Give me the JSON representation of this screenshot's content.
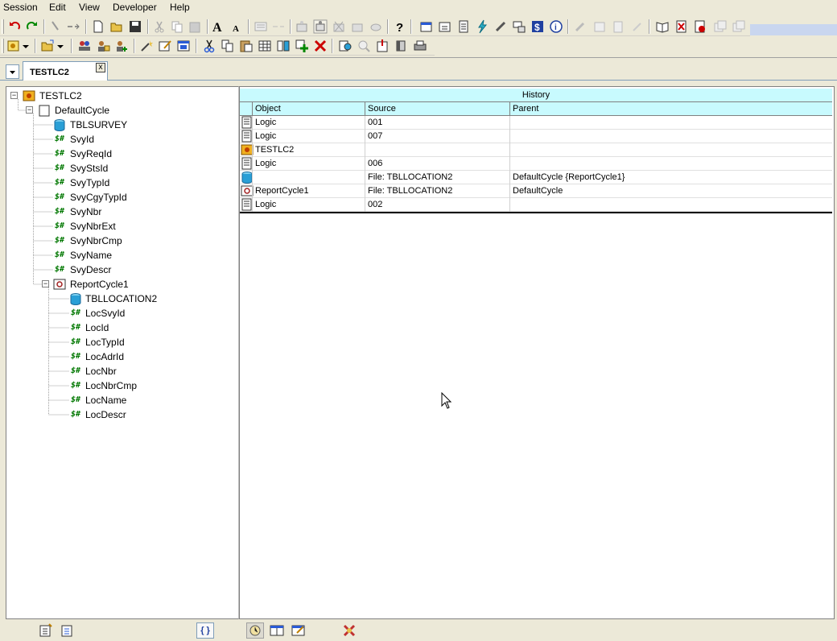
{
  "menu": {
    "items": [
      "Session",
      "Edit",
      "View",
      "Developer",
      "Help"
    ]
  },
  "tabs": {
    "active_label": "TESTLC2",
    "close_glyph": "x",
    "menu_glyph": "▾"
  },
  "tree": {
    "expander_open": "−",
    "root": "TESTLC2",
    "cycle": "DefaultCycle",
    "table1": "TBLSURVEY",
    "field_glyph": "$#",
    "fields1": [
      "SvyId",
      "SvyReqId",
      "SvyStsId",
      "SvyTypId",
      "SvyCgyTypId",
      "SvyNbr",
      "SvyNbrExt",
      "SvyNbrCmp",
      "SvyName",
      "SvyDescr"
    ],
    "report": "ReportCycle1",
    "table2": "TBLLOCATION2",
    "fields2": [
      "LocSvyId",
      "LocId",
      "LocTypId",
      "LocAdrId",
      "LocNbr",
      "LocNbrCmp",
      "LocName",
      "LocDescr"
    ]
  },
  "history": {
    "title": "History",
    "columns": [
      "Object",
      "Source",
      "Parent"
    ],
    "rows": [
      {
        "icon": "logic-icon",
        "object": "Logic",
        "source": "001",
        "parent": ""
      },
      {
        "icon": "logic-icon",
        "object": "Logic",
        "source": "007",
        "parent": ""
      },
      {
        "icon": "session-icon",
        "object": "TESTLC2",
        "source": "",
        "parent": ""
      },
      {
        "icon": "logic-icon",
        "object": "Logic",
        "source": "006",
        "parent": ""
      },
      {
        "icon": "database-icon",
        "object": "",
        "source": "File: TBLLOCATION2",
        "parent": "DefaultCycle {ReportCycle1}"
      },
      {
        "icon": "report-icon",
        "object": "ReportCycle1",
        "source": "File: TBLLOCATION2",
        "parent": "DefaultCycle"
      },
      {
        "icon": "logic-icon",
        "object": "Logic",
        "source": "002",
        "parent": ""
      }
    ]
  },
  "toolbar": {
    "font_larger": "A",
    "font_smaller": "A",
    "help": "?"
  },
  "bottombar": {
    "braces": "{ }"
  },
  "colors": {
    "grid_header_bg": "#c8fafe",
    "window_bg": "#ece9d8",
    "field_icon": "#007700",
    "database_icon": "#2a9fd6"
  }
}
